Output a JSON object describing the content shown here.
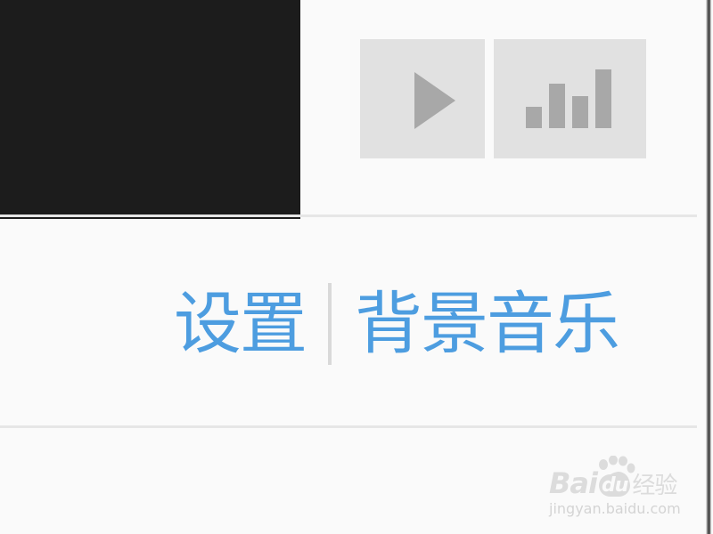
{
  "toolbar": {
    "play_icon": "play-icon",
    "bars_icon": "equalizer-bars-icon"
  },
  "links": {
    "settings": "设置",
    "background_music": "背景音乐"
  },
  "watermark": {
    "brand_bai": "Bai",
    "brand_du": "du",
    "brand_jingyan": "经验",
    "url": "jingyan.baidu.com"
  },
  "colors": {
    "link": "#4d9de0",
    "button_bg": "#e1e1e1",
    "icon": "#a8a8a8",
    "dark_panel": "#1c1c1c"
  }
}
